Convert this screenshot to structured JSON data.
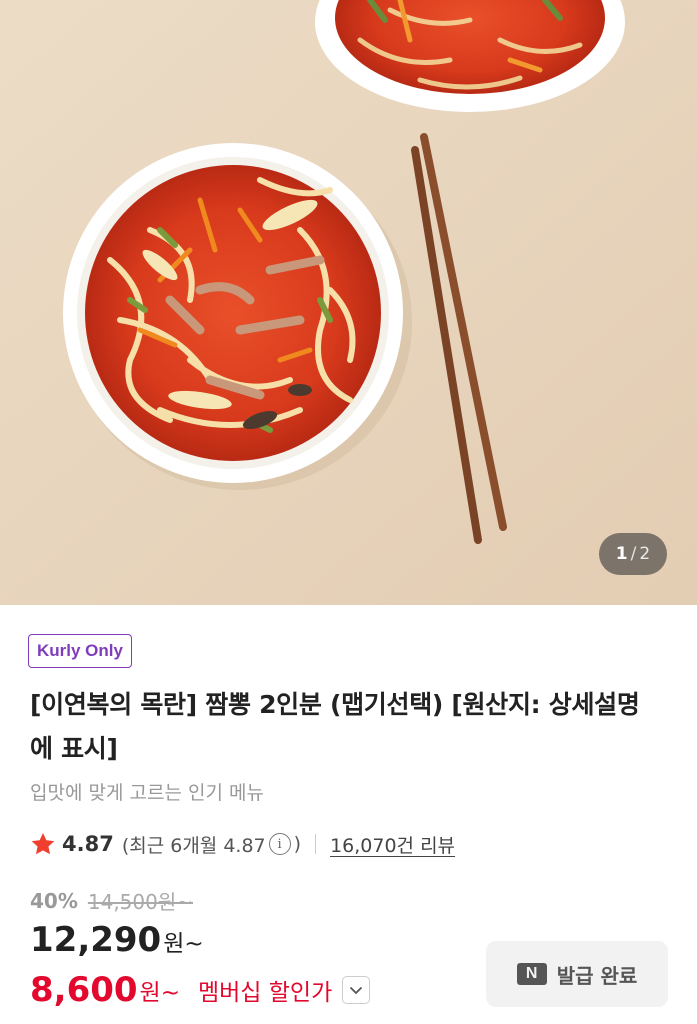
{
  "gallery": {
    "current": "1",
    "separator": "/",
    "total": "2"
  },
  "product": {
    "badge": "Kurly Only",
    "title": "[이연복의 목란] 짬뽕 2인분 (맵기선택) [원산지: 상세설명에 표시]",
    "subtitle": "입맛에 맞게 고르는 인기 메뉴"
  },
  "rating": {
    "icon": "star-icon",
    "score": "4.87",
    "recent_prefix": "(최근 6개월 4.87",
    "info_glyph": "i",
    "recent_suffix": ")",
    "reviews": "16,070건 리뷰"
  },
  "pricing": {
    "discount_rate": "40%",
    "original_price": "14,500원~",
    "price": "12,290",
    "price_unit": "원~",
    "member_price": "8,600",
    "member_unit": "원~",
    "member_label": "멤버십 할인가"
  },
  "coupon": {
    "icon_letter": "N",
    "label": "발급 완료"
  },
  "colors": {
    "brand_purple": "#7f3dbb",
    "sale_red": "#e3092e",
    "star_red": "#f03e2f"
  }
}
